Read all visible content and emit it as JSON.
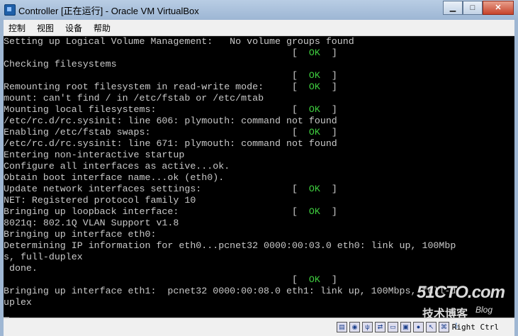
{
  "window": {
    "title": "Controller [正在运行] - Oracle VM VirtualBox",
    "buttons": [
      "▁",
      "□",
      "✕"
    ]
  },
  "menu": [
    "控制",
    "视图",
    "设备",
    "帮助"
  ],
  "console": {
    "lines": [
      "Setting up Logical Volume Management:   No volume groups found",
      "                                                   [  OK  ]",
      "Checking filesystems",
      "                                                   [  OK  ]",
      "Remounting root filesystem in read-write mode:     [  OK  ]",
      "mount: can't find / in /etc/fstab or /etc/mtab",
      "Mounting local filesystems:                        [  OK  ]",
      "/etc/rc.d/rc.sysinit: line 606: plymouth: command not found",
      "Enabling /etc/fstab swaps:                         [  OK  ]",
      "/etc/rc.d/rc.sysinit: line 671: plymouth: command not found",
      "Entering non-interactive startup",
      "Configure all interfaces as active...ok.",
      "Obtain boot interface name...ok (eth0).",
      "Update network interfaces settings:                [  OK  ]",
      "NET: Registered protocol family 10",
      "Bringing up loopback interface:                    [  OK  ]",
      "8021q: 802.1Q VLAN Support v1.8",
      "Bringing up interface eth0:",
      "Determining IP information for eth0...pcnet32 0000:00:03.0 eth0: link up, 100Mbp",
      "s, full-duplex",
      " done.",
      "                                                   [  OK  ]",
      "Bringing up interface eth1:  pcnet32 0000:00:08.0 eth1: link up, 100Mbps, full-d",
      "uplex",
      "_"
    ]
  },
  "watermark": {
    "main": "51CTO.com",
    "sub": "技术博客",
    "blog": "Blog"
  },
  "statusbar": {
    "icons": [
      "hard-disk-icon",
      "optical-drive-icon",
      "usb-icon",
      "network-icon",
      "shared-folder-icon",
      "display-icon",
      "video-capture-icon",
      "mouse-integration-icon",
      "host-key-icon"
    ],
    "host_key": "Right Ctrl"
  }
}
